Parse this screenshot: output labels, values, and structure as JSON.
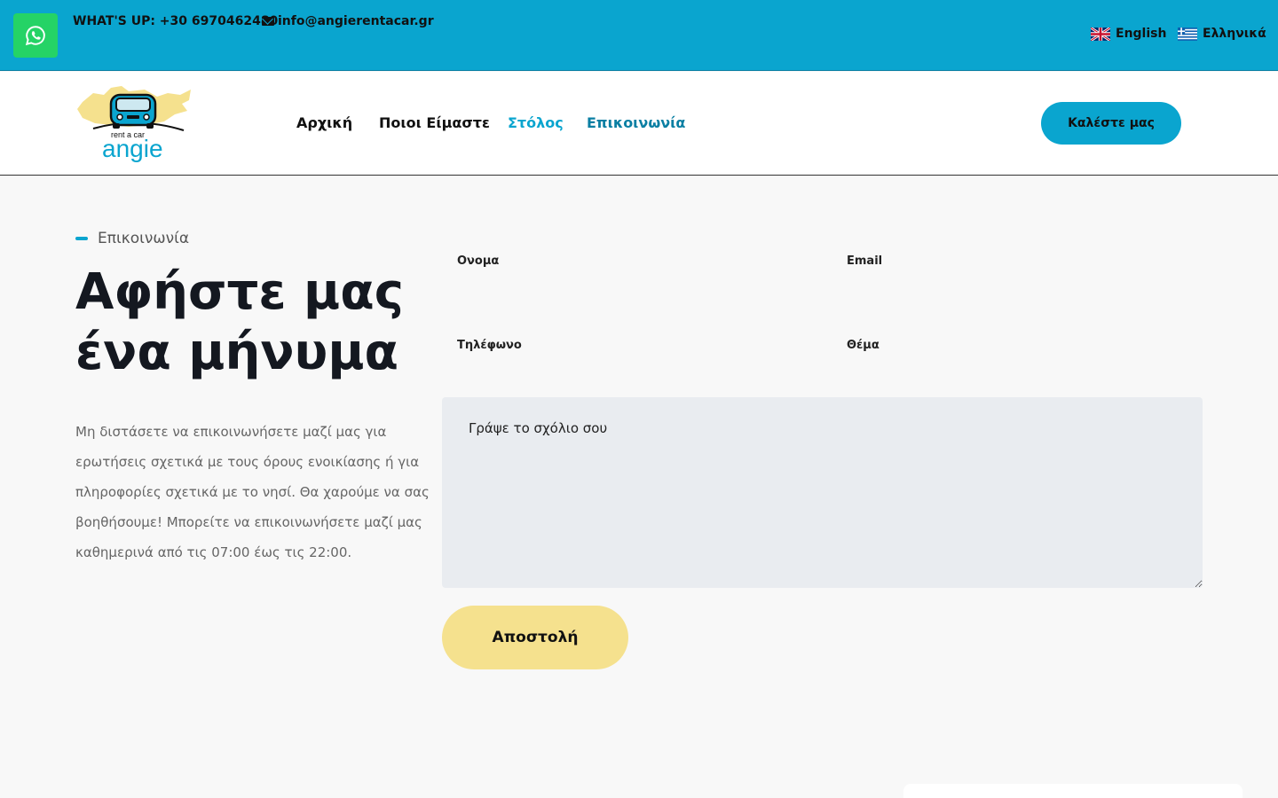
{
  "topbar": {
    "phone_text": "WHAT'S UP: +30 6970462480",
    "email_text": "info@angierentacar.gr",
    "lang_en": "English",
    "lang_el": "Ελληνικά",
    "bg_color": "#0aa5cf"
  },
  "nav": {
    "items": [
      "Αρχική",
      "Ποιοι Είμαστε",
      "Στόλος",
      "Επικοινωνία"
    ],
    "call_button": "Καλέστε μας"
  },
  "logo": {
    "tagline": "rent a car",
    "name": "angie"
  },
  "contact": {
    "tag": "Επικοινωνία",
    "heading": "Αφήστε μας ένα μήνυμα",
    "description": "Μη διστάσετε να επικοινωνήσετε μαζί μας για ερωτήσεις σχετικά με τους όρους ενοικίασης ή για πληροφορίες σχετικά με το νησί. Θα χαρούμε να σας βοηθήσουμε! Μπορείτε να επικοινωνήσετε μαζί μας καθημερινά από τις 07:00 έως τις 22:00.",
    "fields": {
      "name_label": "Ονομα",
      "email_label": "Email",
      "phone_label": "Τηλέφωνο",
      "subject_label": "Θέμα"
    },
    "comment_placeholder": "Γράψε το σχόλιο σου",
    "submit_label": "Αποστολή"
  },
  "colors": {
    "accent": "#0aa5cf",
    "whatsapp": "#25d366",
    "submit": "#f5e18e"
  }
}
